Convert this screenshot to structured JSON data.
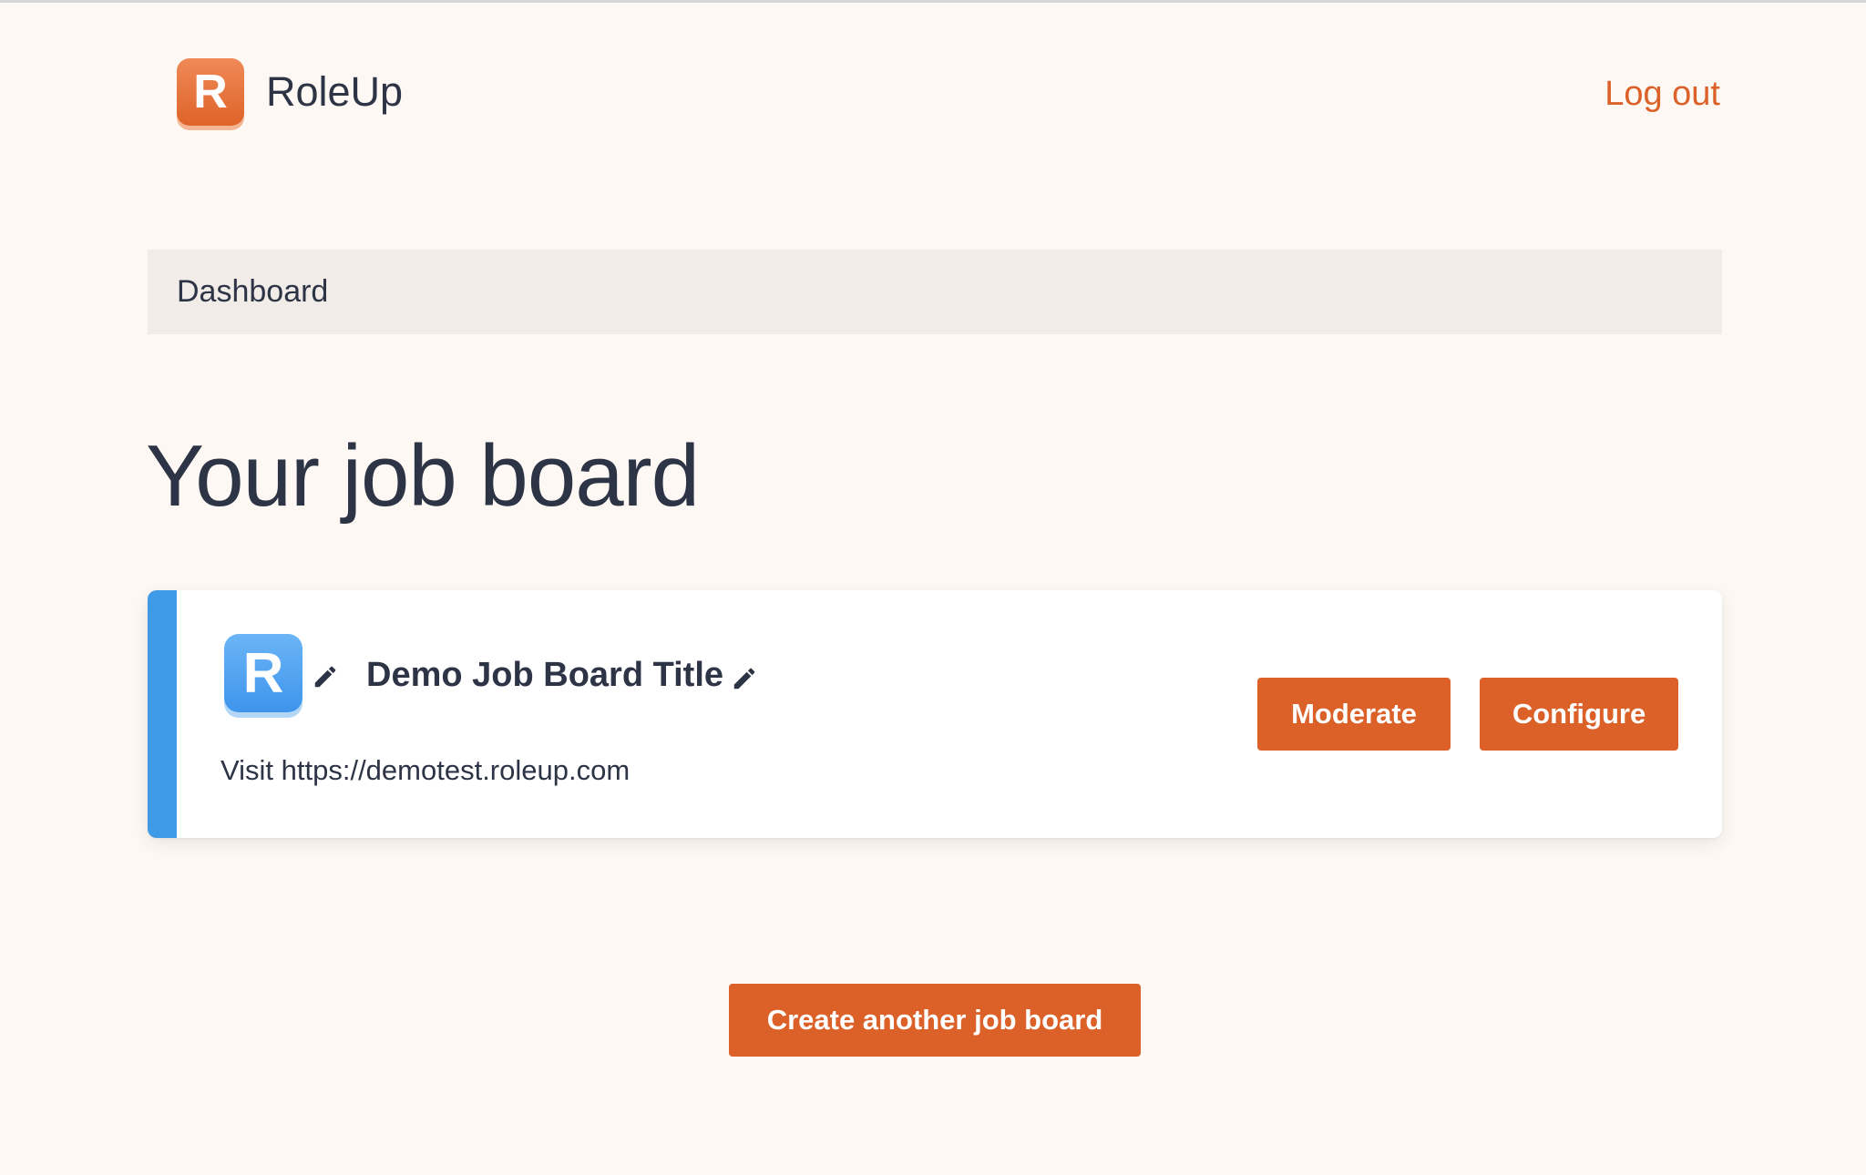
{
  "app": {
    "name": "RoleUp",
    "logo_letter": "R",
    "logout_label": "Log out"
  },
  "breadcrumb": {
    "items": [
      "Dashboard"
    ]
  },
  "page": {
    "title": "Your job board"
  },
  "board": {
    "logo_letter": "R",
    "title": "Demo Job Board Title",
    "visit_prefix": "Visit",
    "url": "https://demotest.roleup.com",
    "actions": {
      "moderate_label": "Moderate",
      "configure_label": "Configure"
    },
    "icons": {
      "edit_logo": "pencil-icon",
      "edit_title": "pencil-icon"
    }
  },
  "footer_actions": {
    "create_label": "Create another job board"
  },
  "colors": {
    "background": "#fdf8f3",
    "accent_orange": "#dc6129",
    "card_accent_blue": "#3f9ae8",
    "breadcrumb_bg": "#f1ece8",
    "text_dark": "#2d3446"
  }
}
